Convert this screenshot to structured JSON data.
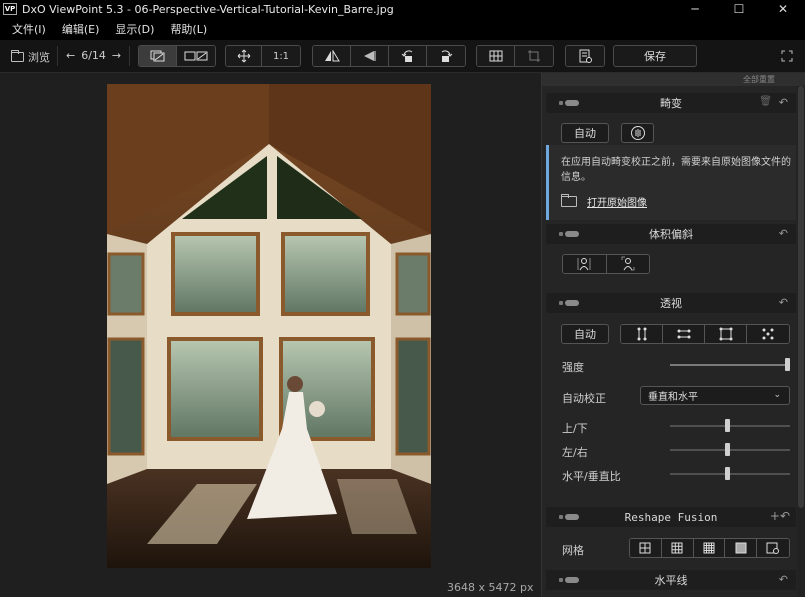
{
  "window": {
    "app_icon_text": "VP",
    "title": "DxO ViewPoint 5.3 - 06-Perspective-Vertical-Tutorial-Kevin_Barre.jpg",
    "controls": [
      "─",
      "☐",
      "✕"
    ]
  },
  "menu": [
    "文件(I)",
    "编辑(E)",
    "显示(D)",
    "帮助(L)"
  ],
  "toolbar": {
    "browse_label": "浏览",
    "prev_arrow": "←",
    "page_indicator": "6/14",
    "next_arrow": "→",
    "zoom_label": "1:1",
    "save_label": "保存"
  },
  "viewer": {
    "dimensions": "3648 x 5472 px"
  },
  "panel": {
    "reset_all": "全部重置",
    "distortion": {
      "title": "畸变",
      "auto_label": "自动",
      "info_text": "在应用自动畸变校正之前，需要来自原始图像文件的信息。",
      "open_original": "打开原始图像"
    },
    "volume": {
      "title": "体积偏斜"
    },
    "perspective": {
      "title": "透视",
      "auto_label": "自动",
      "intensity_label": "强度",
      "intensity_value": 1.0,
      "auto_correct_label": "自动校正",
      "auto_correct_value": "垂直和水平",
      "updown_label": "上/下",
      "updown_value": 0.48,
      "leftright_label": "左/右",
      "leftright_value": 0.48,
      "ratio_label": "水平/垂直比",
      "ratio_value": 0.48
    },
    "reshape": {
      "title": "Reshape Fusion",
      "grid_label": "网格"
    },
    "horizon": {
      "title": "水平线"
    }
  },
  "colors": {
    "accent": "#6fa8dc",
    "panel_bg": "#252525",
    "viewer_bg": "#1f1f1f"
  }
}
